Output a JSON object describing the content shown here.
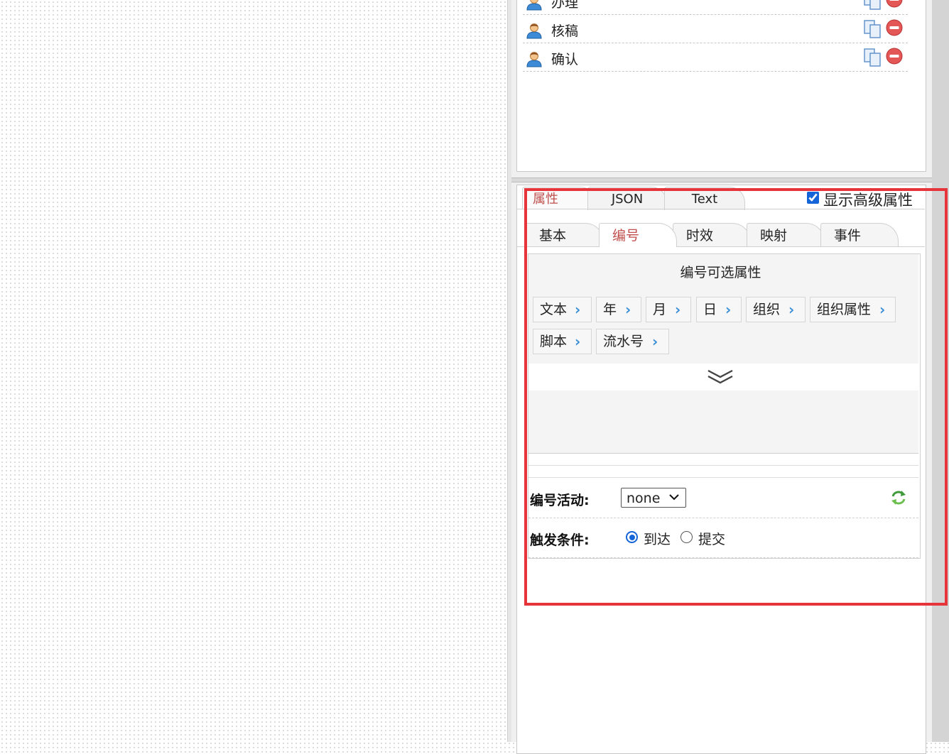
{
  "flow_nodes": [
    {
      "label": "办理"
    },
    {
      "label": "核稿"
    },
    {
      "label": "确认"
    }
  ],
  "property_tabs": [
    "属性",
    "JSON",
    "Text"
  ],
  "active_property_tab": "属性",
  "show_advanced": {
    "label": "显示高级属性",
    "checked": true
  },
  "sub_tabs": [
    "基本",
    "编号",
    "时效",
    "映射",
    "事件"
  ],
  "active_sub_tab": "编号",
  "numbering": {
    "title": "编号可选属性",
    "options": [
      "文本",
      "年",
      "月",
      "日",
      "组织",
      "组织属性",
      "脚本",
      "流水号"
    ]
  },
  "form": {
    "activity": {
      "label": "编号活动:",
      "value": "none"
    },
    "trigger": {
      "label": "触发条件:",
      "options": [
        "到达",
        "提交"
      ],
      "selected": "到达"
    }
  },
  "colors": {
    "accent": "#c0504d",
    "chevron": "#3a8fd6",
    "highlight": "#e5353a",
    "radio": "#1565d8"
  },
  "icons": [
    "user-icon",
    "copy-icon",
    "remove-icon",
    "chevron-right-icon",
    "expand-down-icon",
    "refresh-icon",
    "dropdown-caret-icon"
  ]
}
